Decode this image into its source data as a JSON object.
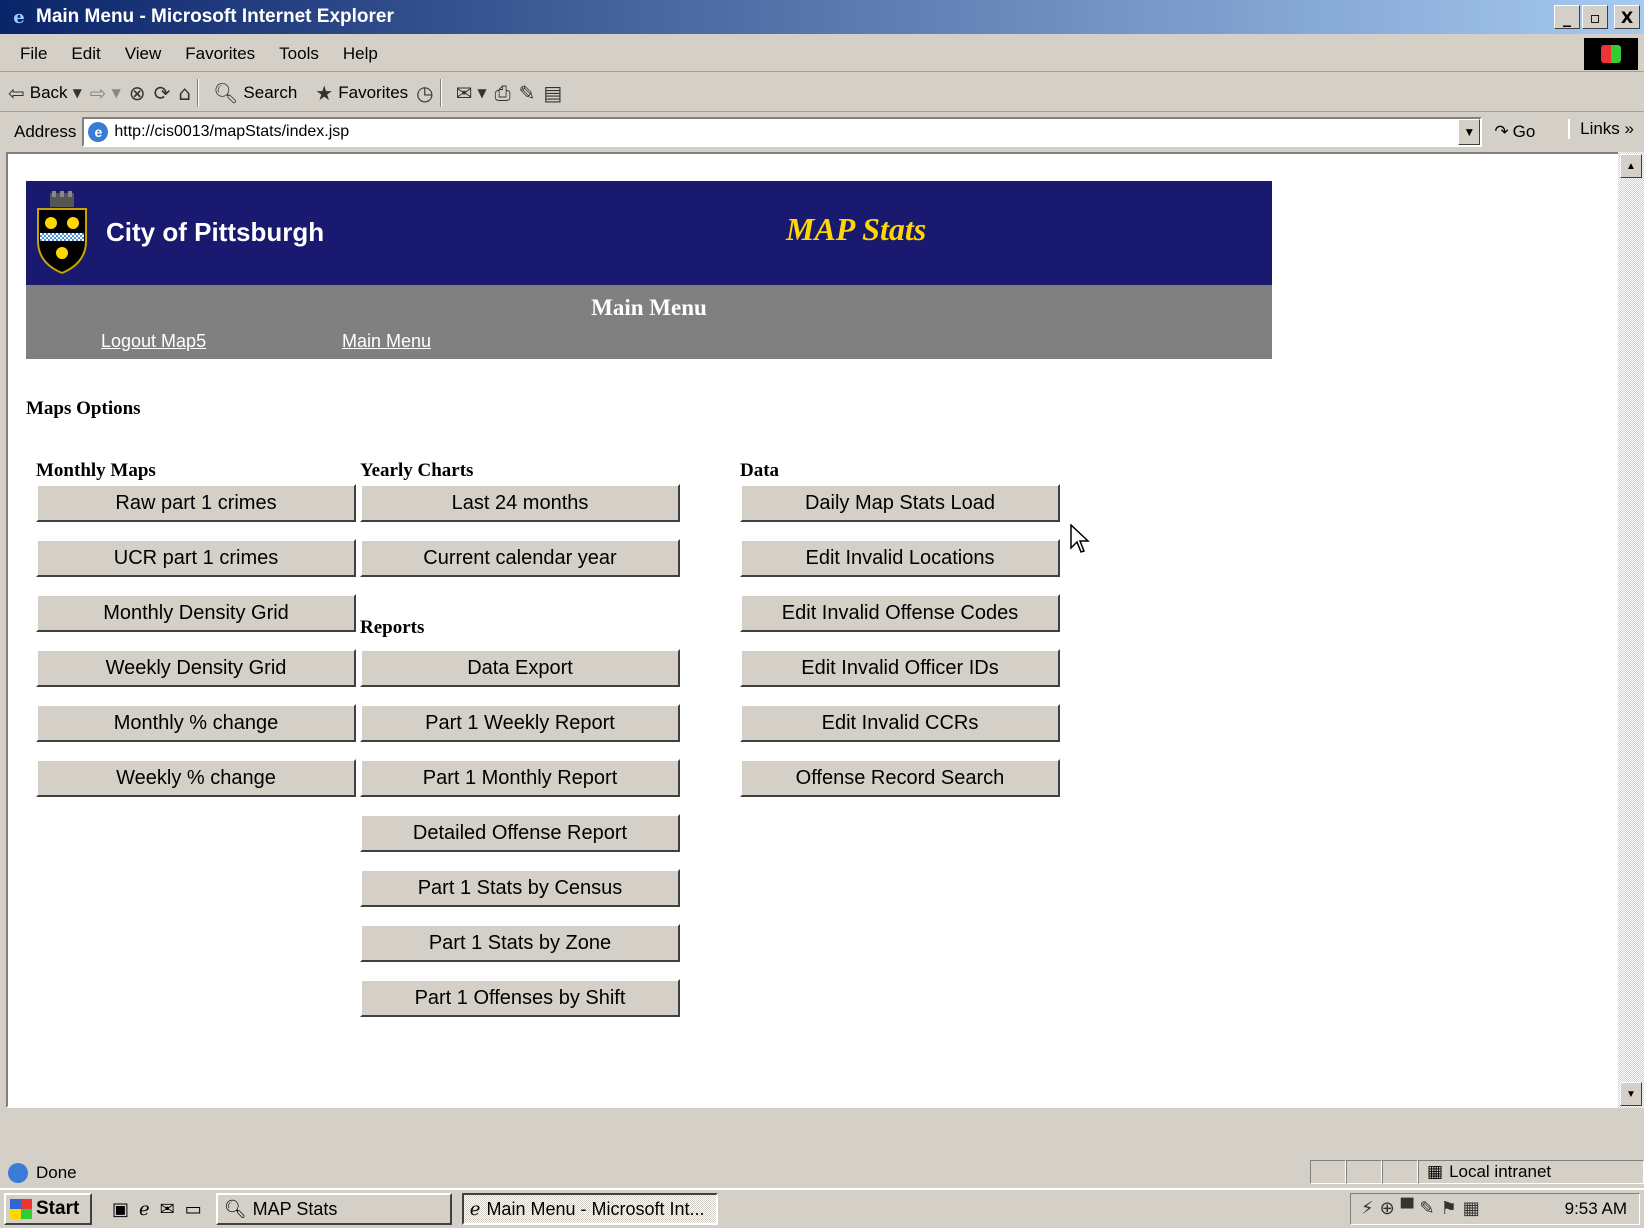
{
  "window": {
    "title": "Main Menu - Microsoft Internet Explorer",
    "min": "_",
    "max": "▫",
    "close": "X"
  },
  "menubar": [
    "File",
    "Edit",
    "View",
    "Favorites",
    "Tools",
    "Help"
  ],
  "toolbar": {
    "back": "Back",
    "search": "Search",
    "favorites": "Favorites"
  },
  "address": {
    "label": "Address",
    "url": "http://cis0013/mapStats/index.jsp",
    "go": "Go",
    "links": "Links"
  },
  "page": {
    "city": "City of Pittsburgh",
    "app_title": "MAP Stats",
    "heading": "Main Menu",
    "nav": {
      "logout": "Logout Map5",
      "main_menu": "Main Menu"
    },
    "section_title": "Maps Options",
    "columns": {
      "monthly_maps": {
        "title": "Monthly Maps",
        "buttons": [
          "Raw part 1 crimes",
          "UCR part 1 crimes",
          "Monthly Density Grid",
          "Weekly Density Grid",
          "Monthly % change",
          "Weekly % change"
        ]
      },
      "yearly_charts": {
        "title": "Yearly Charts",
        "buttons": [
          "Last 24 months",
          "Current calendar year"
        ]
      },
      "reports": {
        "title": "Reports",
        "buttons": [
          "Data Export",
          "Part 1 Weekly Report",
          "Part 1 Monthly Report",
          "Detailed Offense Report",
          "Part 1 Stats by Census",
          "Part 1 Stats by Zone",
          "Part 1 Offenses by Shift"
        ]
      },
      "data": {
        "title": "Data",
        "buttons": [
          "Daily Map Stats Load",
          "Edit Invalid Locations",
          "Edit Invalid Offense Codes",
          "Edit Invalid Officer IDs",
          "Edit Invalid CCRs",
          "Offense Record Search"
        ]
      }
    }
  },
  "status": {
    "text": "Done",
    "zone": "Local intranet"
  },
  "taskbar": {
    "start": "Start",
    "tasks": [
      "MAP Stats",
      "Main Menu - Microsoft Int..."
    ],
    "time": "9:53 AM"
  },
  "colors": {
    "banner": "#191970",
    "app_title": "#ffd700",
    "grey_bar": "#808080"
  }
}
